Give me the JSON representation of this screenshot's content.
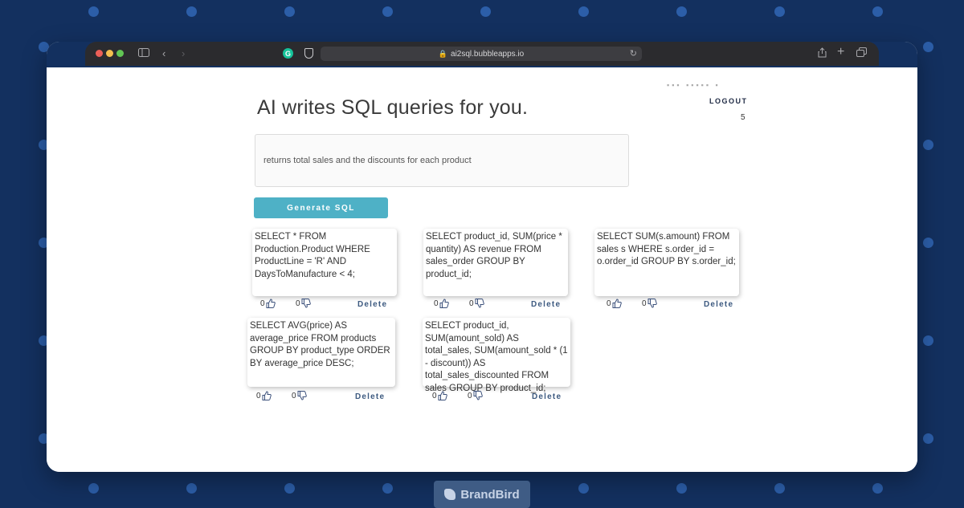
{
  "browser": {
    "url": "ai2sql.bubbleapps.io"
  },
  "header": {
    "title": "AI writes SQL queries for you.",
    "user_name": "▪▪▪ ▪▪▪▪▪ ▪",
    "logout_label": "LOGOUT",
    "credits": "5"
  },
  "prompt": {
    "value": "returns total sales and the discounts for each product"
  },
  "generate_button": {
    "label": "Generate SQL"
  },
  "queries": [
    {
      "sql": "SELECT  * FROM Production.Product WHERE ProductLine = 'R' AND DaysToManufacture < 4;",
      "likes": "0",
      "dislikes": "0",
      "delete_label": "Delete"
    },
    {
      "sql": "SELECT  product_id, SUM(price * quantity) AS revenue FROM sales_order GROUP BY product_id;",
      "likes": "0",
      "dislikes": "0",
      "delete_label": "Delete"
    },
    {
      "sql": "SELECT  SUM(s.amount) FROM sales s WHERE s.order_id = o.order_id GROUP BY s.order_id;",
      "likes": "0",
      "dislikes": "0",
      "delete_label": "Delete"
    },
    {
      "sql": "SELECT  AVG(price) AS average_price FROM products GROUP BY product_type ORDER BY average_price DESC;",
      "likes": "0",
      "dislikes": "0",
      "delete_label": "Delete"
    },
    {
      "sql": "SELECT  product_id, SUM(amount_sold) AS total_sales, SUM(amount_sold * (1 - discount)) AS total_sales_discounted FROM sales GROUP BY product_id;",
      "likes": "0",
      "dislikes": "0",
      "delete_label": "Delete"
    }
  ],
  "watermark": {
    "label": "BrandBird"
  },
  "colors": {
    "background": "#13305f",
    "accent": "#4eb1c6",
    "delete_link": "#3d5a80"
  }
}
